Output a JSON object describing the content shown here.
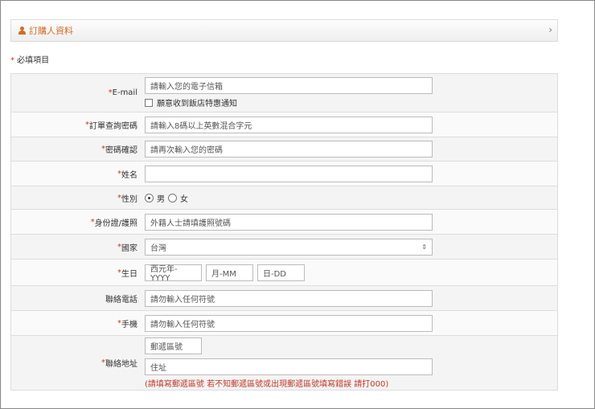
{
  "panel": {
    "title": "訂購人資料",
    "icon": "user-icon",
    "chevron": "›",
    "accent_color": "#d46b26"
  },
  "required_note": {
    "star": "*",
    "text": " 必填項目"
  },
  "form": {
    "email": {
      "label": "E-mail",
      "placeholder": "請輸入您的電子信箱",
      "opt_in_label": "願意收到飯店特惠通知"
    },
    "password": {
      "label": "訂單查詢密碼",
      "placeholder": "請輸入8碼以上英數混合字元"
    },
    "password_confirm": {
      "label": "密碼確認",
      "placeholder": "請再次輸入您的密碼"
    },
    "name": {
      "label": "姓名",
      "value": ""
    },
    "gender": {
      "label": "性別",
      "options": [
        "男",
        "女"
      ],
      "selected": "男"
    },
    "id_number": {
      "label": "身份證/護照",
      "placeholder": "外籍人士請填護照號碼"
    },
    "country": {
      "label": "國家",
      "value": "台灣",
      "arrow": "⇕"
    },
    "birthday": {
      "label": "生日",
      "year_placeholder": "西元年-YYYY",
      "month_placeholder": "月-MM",
      "day_placeholder": "日-DD"
    },
    "phone": {
      "label": "聯絡電話",
      "placeholder": "請勿輸入任何符號"
    },
    "mobile": {
      "label": "手機",
      "placeholder": "請勿輸入任何符號"
    },
    "address": {
      "label": "聯絡地址",
      "zip_placeholder": "郵遞區號",
      "address_placeholder": "住址",
      "hint": "(請填寫郵遞區號 若不知郵遞區號或出現郵遞區號填寫錯誤 請打000)"
    }
  }
}
